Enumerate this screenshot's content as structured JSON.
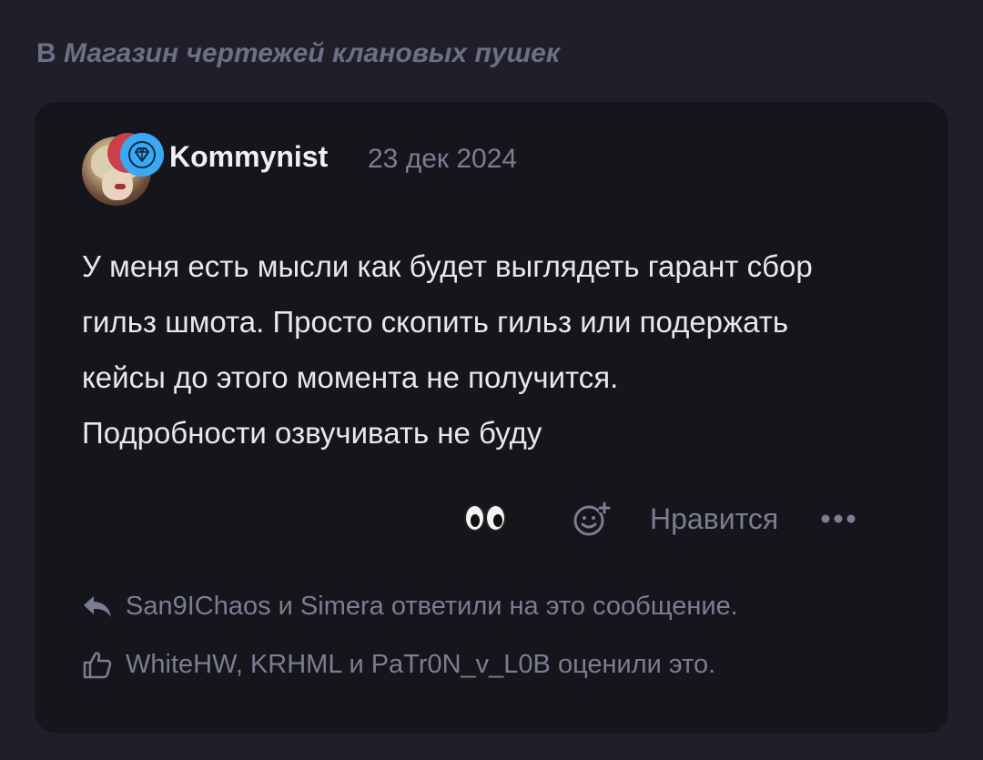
{
  "breadcrumb": {
    "prefix": "В",
    "forum_title": "Магазин чертежей клановых пушек"
  },
  "post": {
    "author": "Kommynist",
    "date": "23 дек 2024",
    "body_lines": [
      "У меня есть мысли как будет выглядеть гарант сбор",
      "гильз шмота. Просто скопить гильз или подержать",
      "кейсы до этого момента не получится.",
      "Подробности озвучивать не буду"
    ],
    "actions": {
      "reaction_icon": "eyes-emoji",
      "add_reaction_icon": "smiley-plus-icon",
      "like_label": "Нравится",
      "more_icon": "more-dots-icon"
    },
    "replies_text": "San9IChaos и Simera ответили на это сообщение.",
    "likes_text": "WhiteHW, KRHML и PaTr0N_v_L0B оценили это."
  },
  "colors": {
    "background": "#1f1f29",
    "card": "#15151c",
    "muted_text": "#7d7d92",
    "badge_blue": "#3aa8f2",
    "badge_red": "#c9404c"
  }
}
